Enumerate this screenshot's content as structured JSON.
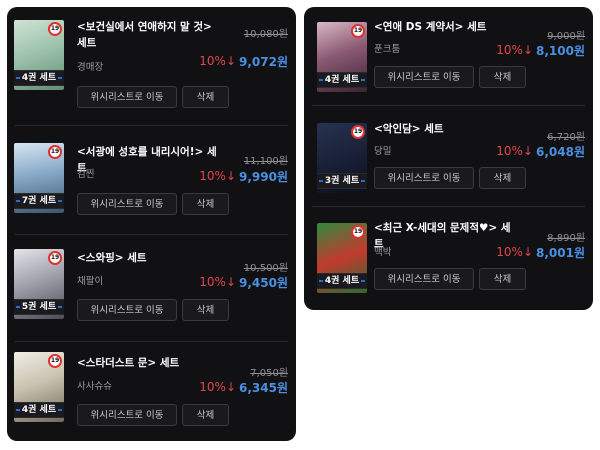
{
  "left_items": [
    {
      "title": "<보건실에서 연애하지 말 것> 세트",
      "author": "경매장",
      "badge": "4권 세트",
      "age": "19",
      "original_price": "10,080원",
      "discount": "10%↓",
      "price": "9,072원",
      "wishlist_label": "위시리스트로 이동",
      "delete_label": "삭제"
    },
    {
      "title": "<서광에 성호를 내리시어!> 세트",
      "author": "김찐",
      "badge": "7권 세트",
      "age": "19",
      "original_price": "11,100원",
      "discount": "10%↓",
      "price": "9,990원",
      "wishlist_label": "위시리스트로 이동",
      "delete_label": "삭제"
    },
    {
      "title": "<스와핑> 세트",
      "author": "채팔이",
      "badge": "5권 세트",
      "age": "19",
      "original_price": "10,500원",
      "discount": "10%↓",
      "price": "9,450원",
      "wishlist_label": "위시리스트로 이동",
      "delete_label": "삭제"
    },
    {
      "title": "<스타더스트 문> 세트",
      "author": "사사슈슈",
      "badge": "4권 세트",
      "age": "19",
      "original_price": "7,050원",
      "discount": "10%↓",
      "price": "6,345원",
      "wishlist_label": "위시리스트로 이동",
      "delete_label": "삭제"
    }
  ],
  "right_items": [
    {
      "title": "<연애 DS 계약서> 세트",
      "author": "푼크툼",
      "badge": "4권 세트",
      "age": "19",
      "original_price": "9,000원",
      "discount": "10%↓",
      "price": "8,100원",
      "wishlist_label": "위시리스트로 이동",
      "delete_label": "삭제"
    },
    {
      "title": "<악인담> 세트",
      "author": "당밀",
      "badge": "3권 세트",
      "age": "19",
      "original_price": "6,720원",
      "discount": "10%↓",
      "price": "6,048원",
      "wishlist_label": "위시리스트로 이동",
      "delete_label": "삭제"
    },
    {
      "title": "<최근 X-세대의 문제적♥> 세트",
      "author": "맥박",
      "badge": "4권 세트",
      "age": "19",
      "original_price": "8,890원",
      "discount": "10%↓",
      "price": "8,001원",
      "wishlist_label": "위시리스트로 이동",
      "delete_label": "삭제"
    }
  ],
  "colors": {
    "panel": "#111114",
    "discount": "#e0454f",
    "price": "#4a90e2",
    "badge_accent": "#1e6fd9",
    "age_ring": "#e0302f"
  }
}
